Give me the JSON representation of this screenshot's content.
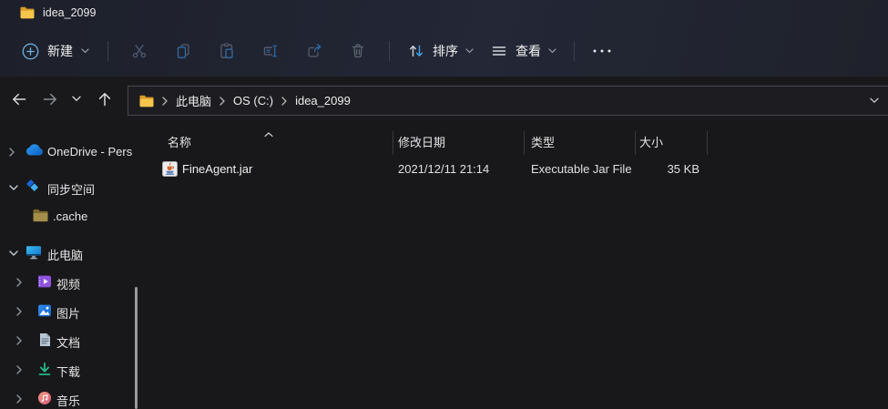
{
  "window": {
    "title": "idea_2099"
  },
  "toolbar": {
    "new_label": "新建",
    "sort_label": "排序",
    "view_label": "查看"
  },
  "address": {
    "crumbs": [
      "此电脑",
      "OS (C:)",
      "idea_2099"
    ]
  },
  "sidebar": {
    "items": [
      {
        "label": "OneDrive - Pers"
      },
      {
        "label": "同步空间"
      },
      {
        "label": ".cache"
      },
      {
        "label": "此电脑"
      },
      {
        "label": "视频"
      },
      {
        "label": "图片"
      },
      {
        "label": "文档"
      },
      {
        "label": "下载"
      },
      {
        "label": "音乐"
      }
    ]
  },
  "filelist": {
    "columns": [
      "名称",
      "修改日期",
      "类型",
      "大小"
    ],
    "rows": [
      {
        "name": "FineAgent.jar",
        "date_modified": "2021/12/11 21:14",
        "type": "Executable Jar File",
        "size": "35 KB"
      }
    ]
  },
  "colors": {
    "accent_blue": "#3fa3ef",
    "folder_yellow": "#f5c64b"
  }
}
